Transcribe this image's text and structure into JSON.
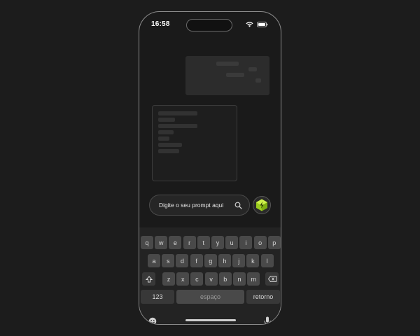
{
  "status_bar": {
    "time": "16:58",
    "wifi_icon": "wifi-icon",
    "battery_icon": "battery-icon"
  },
  "prompt": {
    "placeholder": "Digite o seu prompt aqui",
    "search_icon": "search-icon"
  },
  "action_button": {
    "icon": "sparkle-cube-icon",
    "accent": "#b7e634"
  },
  "keyboard": {
    "row1": [
      "q",
      "w",
      "e",
      "r",
      "t",
      "y",
      "u",
      "i",
      "o",
      "p"
    ],
    "row2": [
      "a",
      "s",
      "d",
      "f",
      "g",
      "h",
      "j",
      "k",
      "l"
    ],
    "row3": [
      "z",
      "x",
      "c",
      "v",
      "b",
      "n",
      "m"
    ],
    "shift_icon": "shift-icon",
    "backspace_icon": "backspace-icon",
    "numbers_label": "123",
    "space_label": "espaço",
    "return_label": "retorno",
    "emoji_icon": "emoji-icon",
    "mic_icon": "microphone-icon"
  },
  "colors": {
    "background": "#1c1c1c",
    "phone_frame": "#8a8a8a",
    "key": "#494949"
  }
}
